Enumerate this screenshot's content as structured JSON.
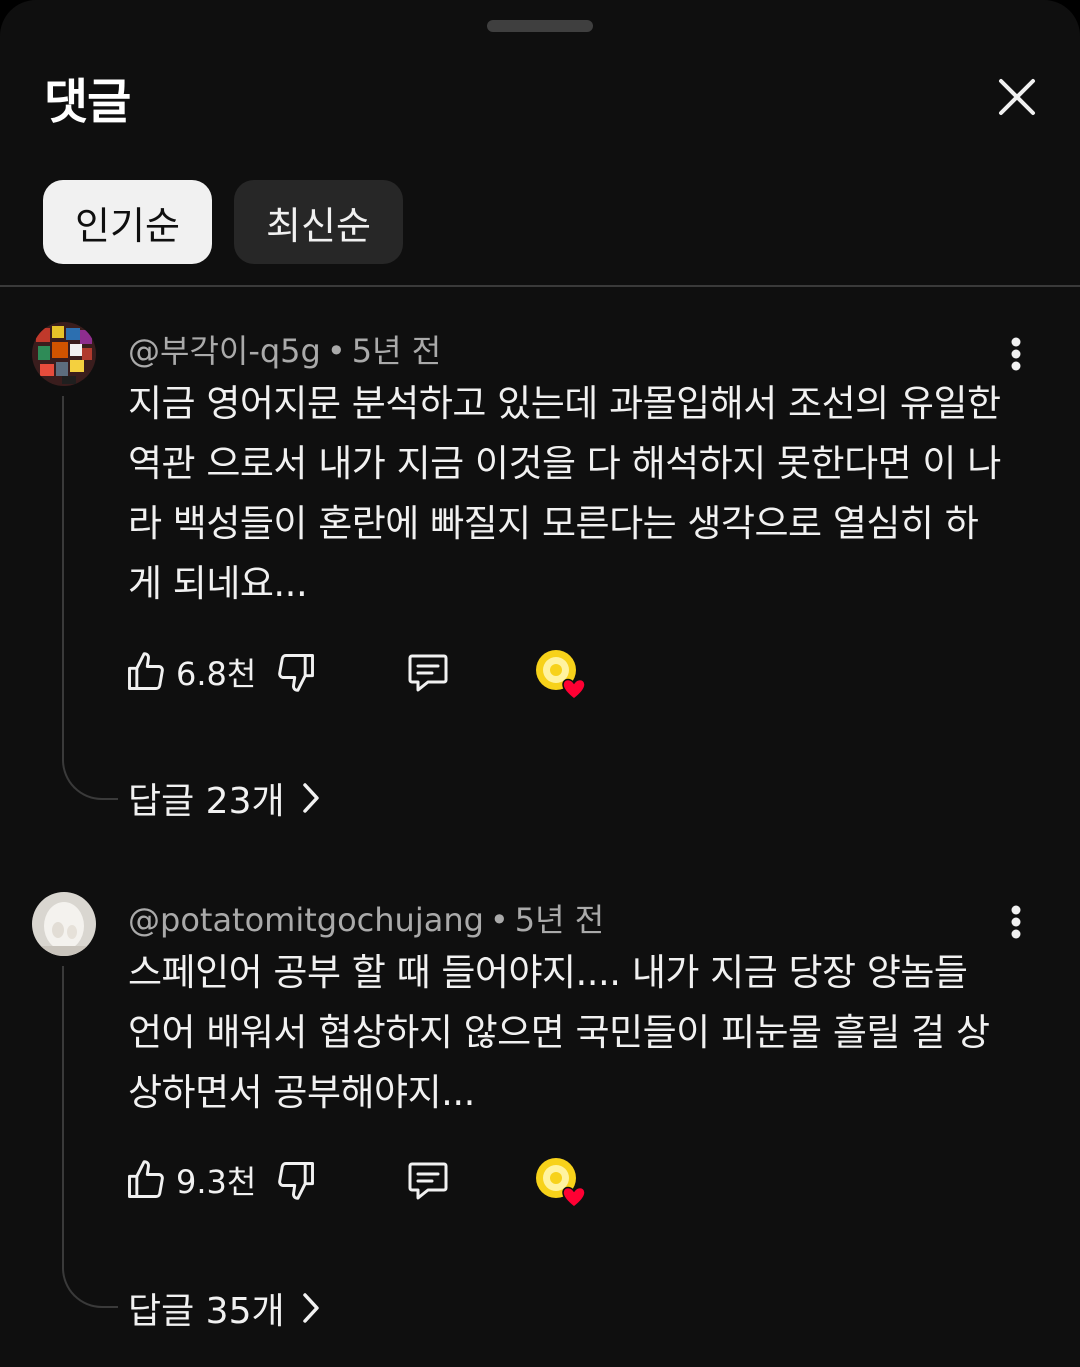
{
  "header": {
    "title": "댓글"
  },
  "sort_tabs": [
    {
      "label": "인기순",
      "active": true
    },
    {
      "label": "최신순",
      "active": false
    }
  ],
  "comments": [
    {
      "author": "@부각이-q5g",
      "time": "5년 전",
      "text": "지금 영어지문 분석하고 있는데 과몰입해서  조선의 유일한 역관 으로서 내가 지금 이것을 다 해석하지 못한다면 이 나라 백성들이 혼란에 빠질지 모른다는 생각으로 열심히 하게 되네요...",
      "likes": "6.8천",
      "replies": "답글 23개"
    },
    {
      "author": "@potatomitgochujang",
      "time": "5년 전",
      "text": "스페인어 공부 할 때 들어야지.... 내가 지금 당장 양놈들 언어 배워서 협상하지 않으면 국민들이 피눈물 흘릴 걸 상상하면서 공부해야지...",
      "likes": "9.3천",
      "replies": "답글 35개"
    }
  ],
  "icons": {
    "close": "close-icon",
    "like": "thumbs-up-icon",
    "dislike": "thumbs-down-icon",
    "reply": "reply-icon",
    "more": "more-vert-icon",
    "creator_heart": "creator-heart-icon",
    "chevron": "chevron-right-icon"
  },
  "colors": {
    "background": "#0f0f0f",
    "chip_active": "#f1f1f1",
    "chip_inactive": "#272727",
    "heart": "#ff0033"
  }
}
